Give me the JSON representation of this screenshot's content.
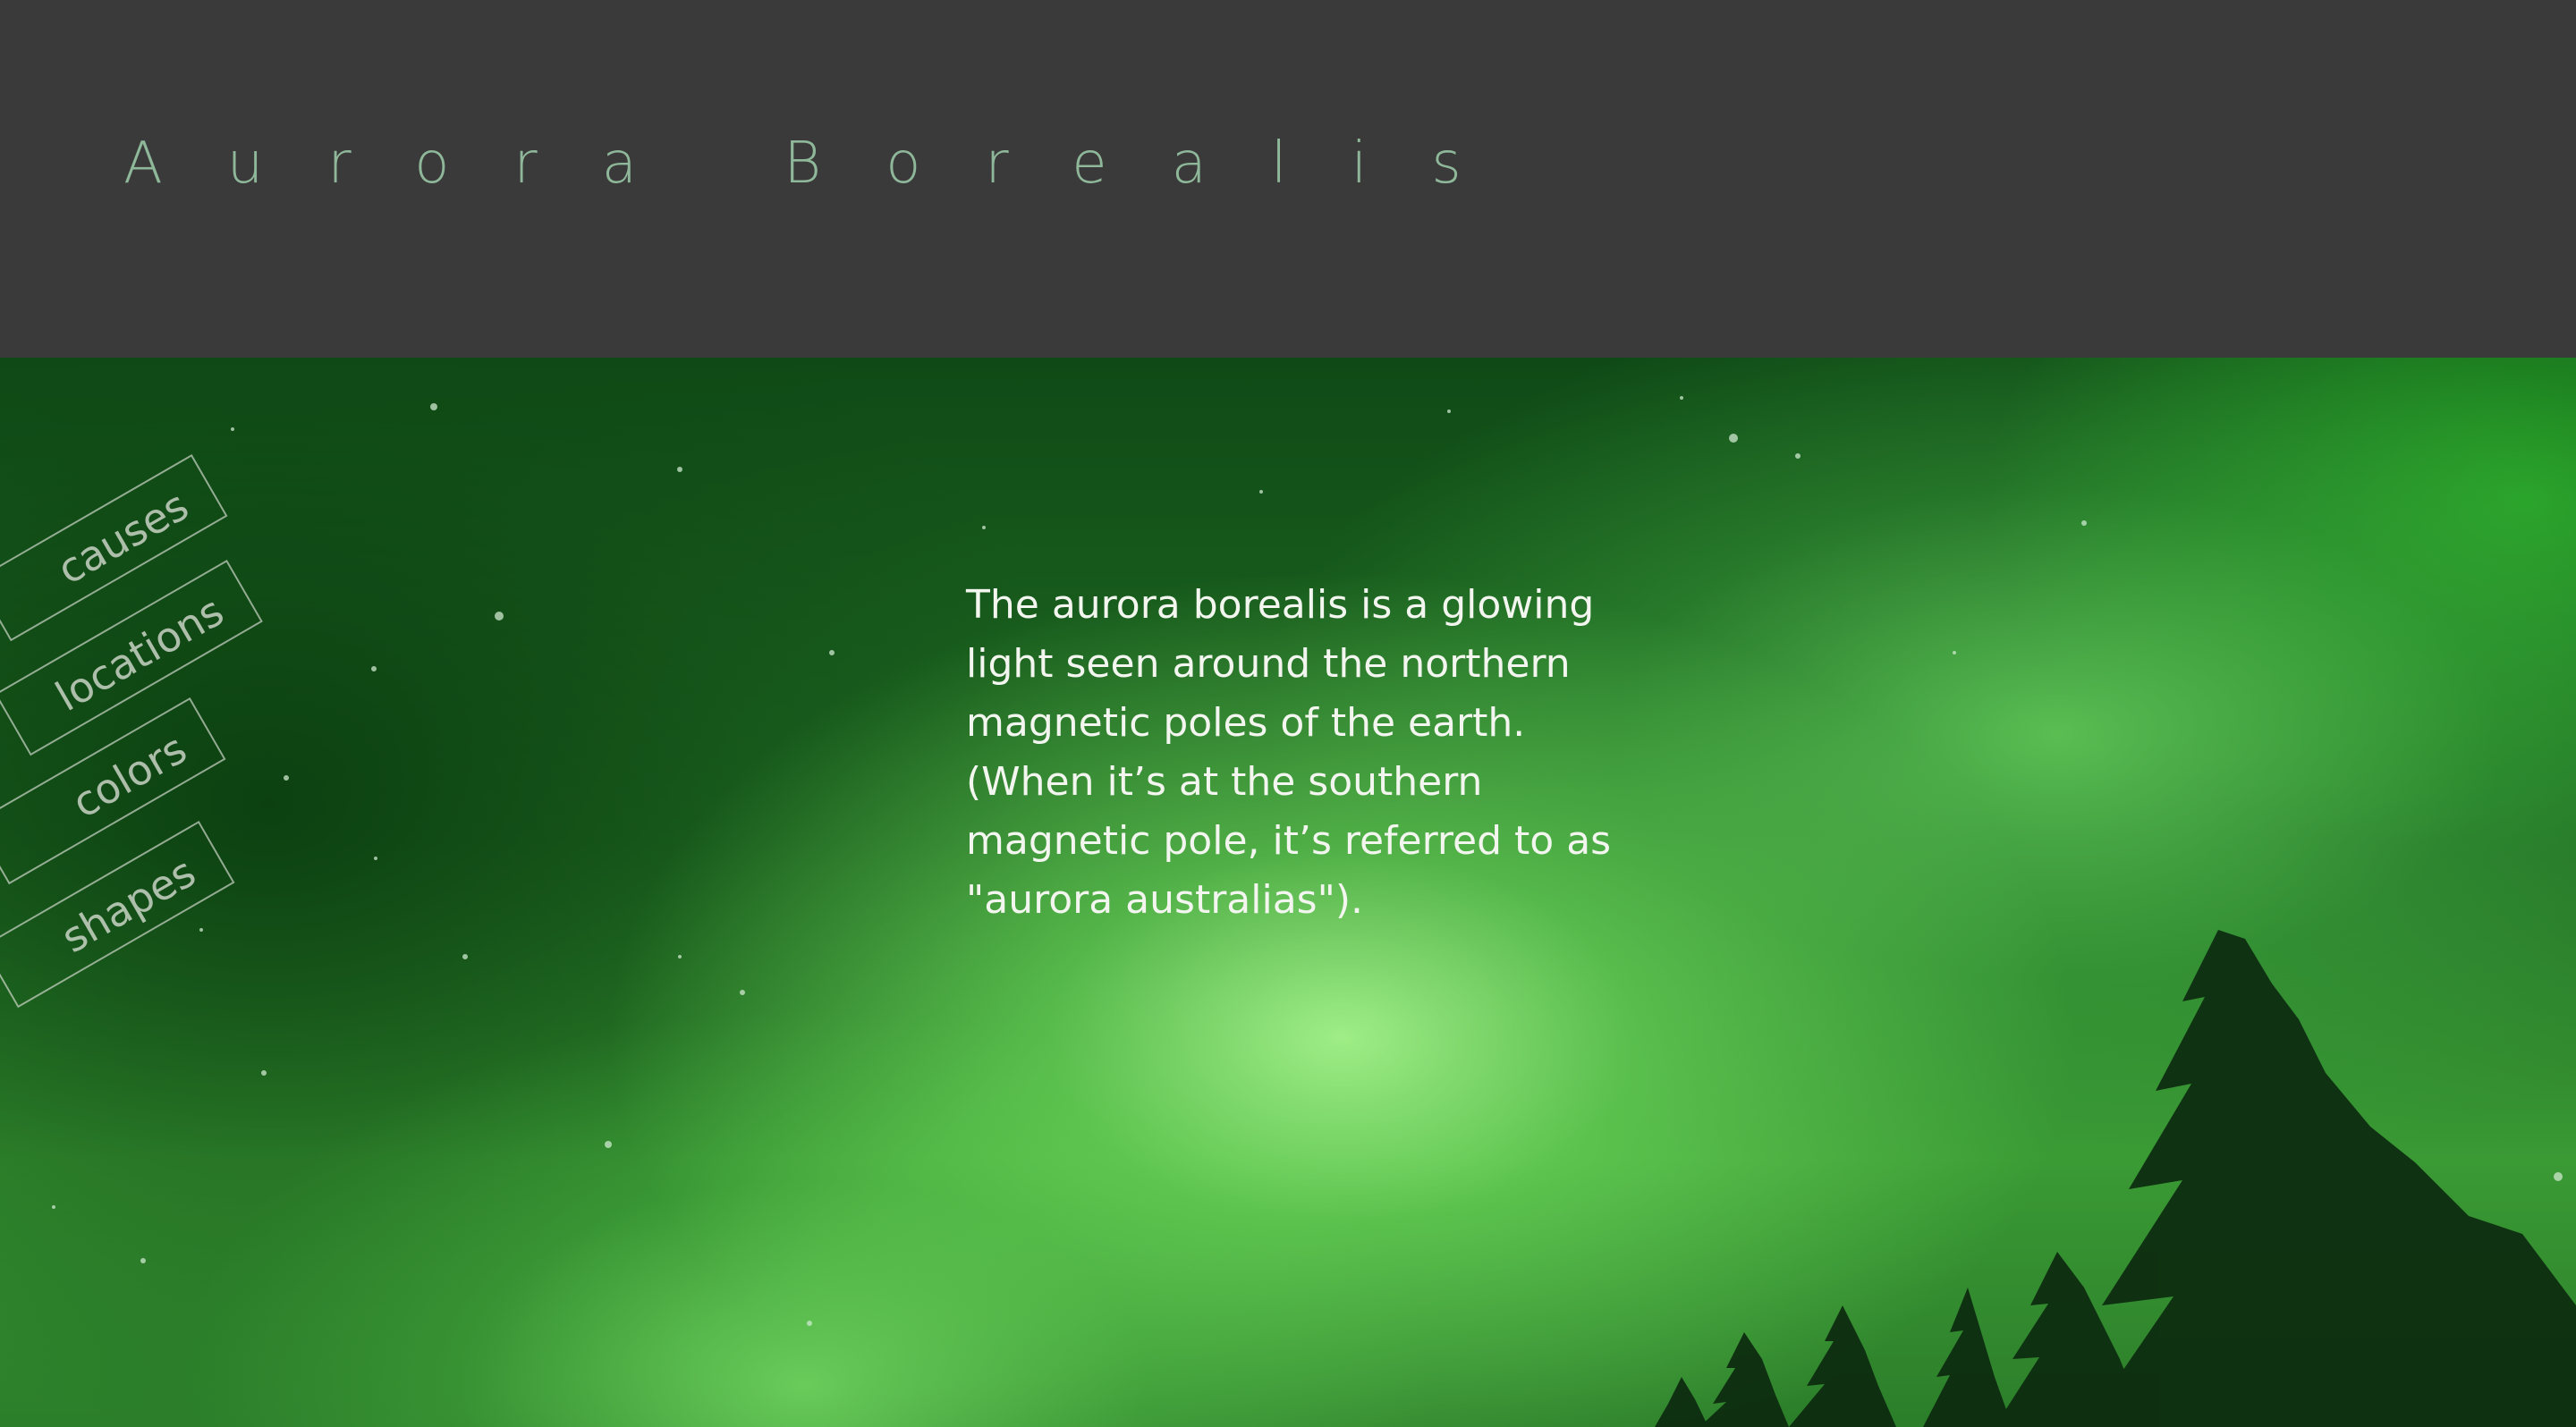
{
  "header": {
    "title": "Aurora Borealis"
  },
  "nav": {
    "items": [
      {
        "label": "causes"
      },
      {
        "label": "locations"
      },
      {
        "label": "colors"
      },
      {
        "label": "shapes"
      }
    ]
  },
  "main": {
    "intro_text": "The aurora borealis is a glowing light seen around the northern magnetic poles of the earth. (When it’s at the southern magnetic pole, it’s referred to as \"aurora australias\")."
  },
  "colors": {
    "header_bg": "#3a3a3a",
    "title": "#8fb89a",
    "nav_text": "#e1e6dc",
    "body_text": "#f2f6ef",
    "aurora_green": "#7be86a"
  },
  "images": {
    "hero": "aurora-night-sky-photo"
  }
}
